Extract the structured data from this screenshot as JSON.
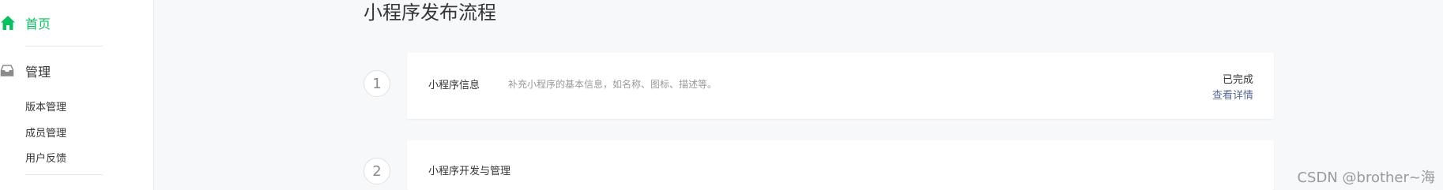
{
  "sidebar": {
    "home_label": "首页",
    "manage_label": "管理",
    "sub_items": [
      "版本管理",
      "成员管理",
      "用户反馈"
    ]
  },
  "main": {
    "title": "小程序发布流程",
    "steps": [
      {
        "number": "1",
        "title": "小程序信息",
        "description": "补充小程序的基本信息，如名称、图标、描述等。",
        "status": "已完成",
        "link": "查看详情"
      },
      {
        "number": "2",
        "title": "小程序开发与管理"
      }
    ]
  },
  "watermark": "CSDN @brother~海",
  "colors": {
    "accent": "#07c160",
    "link": "#576b95"
  },
  "icons": {
    "home": "home-icon",
    "manage": "inbox-icon"
  }
}
